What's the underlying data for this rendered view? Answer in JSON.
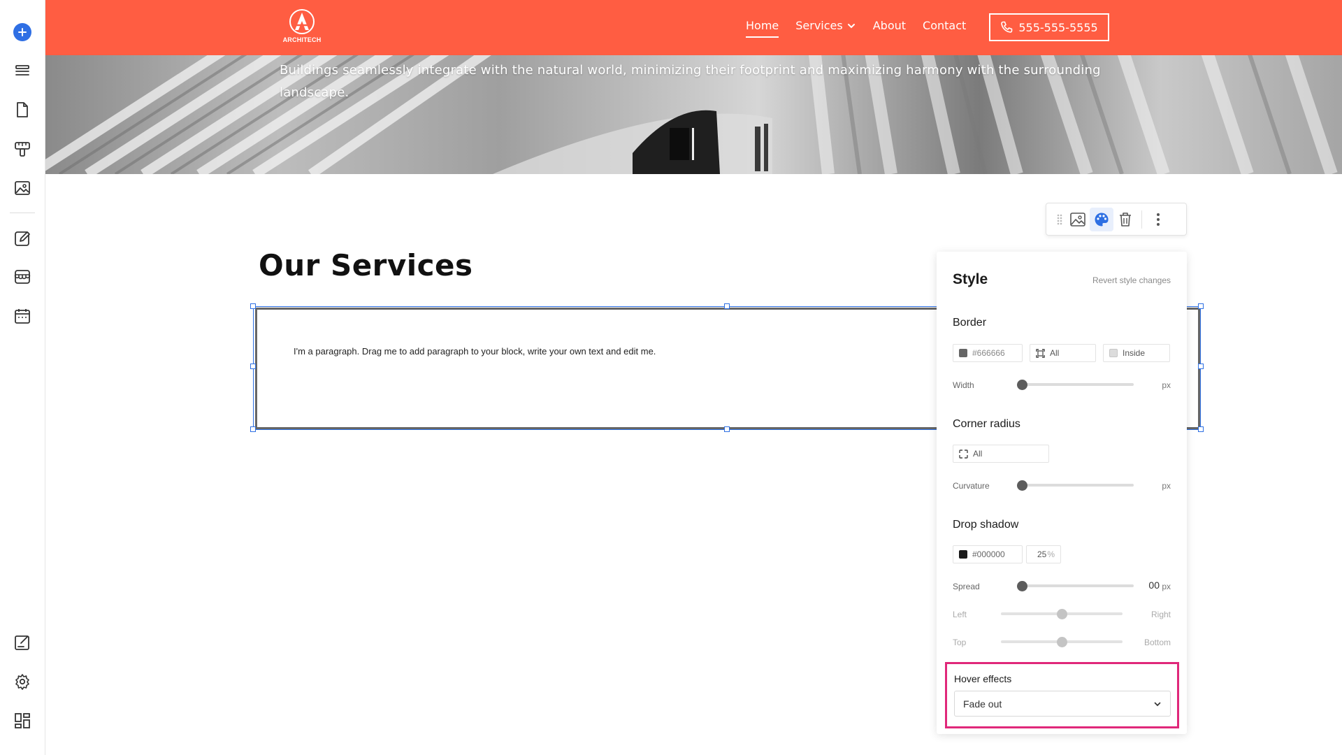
{
  "header": {
    "logo_text": "ARCHITECH",
    "nav": [
      {
        "label": "Home"
      },
      {
        "label": "Services"
      },
      {
        "label": "About"
      },
      {
        "label": "Contact"
      }
    ],
    "phone": "555-555-5555"
  },
  "hero": {
    "text": "Buildings seamlessly integrate with the natural world, minimizing their footprint and maximizing harmony with the surrounding landscape."
  },
  "main": {
    "section_title": "Our Services",
    "paragraph": "I'm a paragraph. Drag me to add paragraph to your block, write your own text and edit me."
  },
  "style_panel": {
    "title": "Style",
    "revert": "Revert style changes",
    "border": {
      "heading": "Border",
      "color": "#666666",
      "sides": "All",
      "position": "Inside",
      "width_label": "Width",
      "unit": "px",
      "width_level": 0.0
    },
    "corner_radius": {
      "heading": "Corner radius",
      "corners": "All",
      "curvature_label": "Curvature",
      "unit": "px",
      "curvature_level": 0.0
    },
    "drop_shadow": {
      "heading": "Drop shadow",
      "color": "#000000",
      "opacity": "25",
      "opacity_unit": "%",
      "spread_label": "Spread",
      "spread_value": "00",
      "unit": "px",
      "spread_level": 0.0,
      "left_label": "Left",
      "right_label": "Right",
      "top_label": "Top",
      "bottom_label": "Bottom",
      "horizontal_level": 0.5,
      "vertical_level": 0.5
    },
    "hover": {
      "heading": "Hover effects",
      "value": "Fade out"
    }
  },
  "colors": {
    "header_bg": "#ff5d42",
    "accent_blue": "#2d6fe3",
    "highlight_pink": "#e0287a"
  },
  "icons": {
    "rail": [
      "add-icon",
      "layers-icon",
      "page-icon",
      "paint-roller-icon",
      "image-icon",
      "edit-icon",
      "store-icon",
      "calendar-icon",
      "design-icon",
      "settings-icon",
      "apps-icon"
    ],
    "toolbar": [
      "drag-handle-icon",
      "image-icon",
      "palette-icon",
      "trash-icon",
      "more-icon"
    ]
  }
}
